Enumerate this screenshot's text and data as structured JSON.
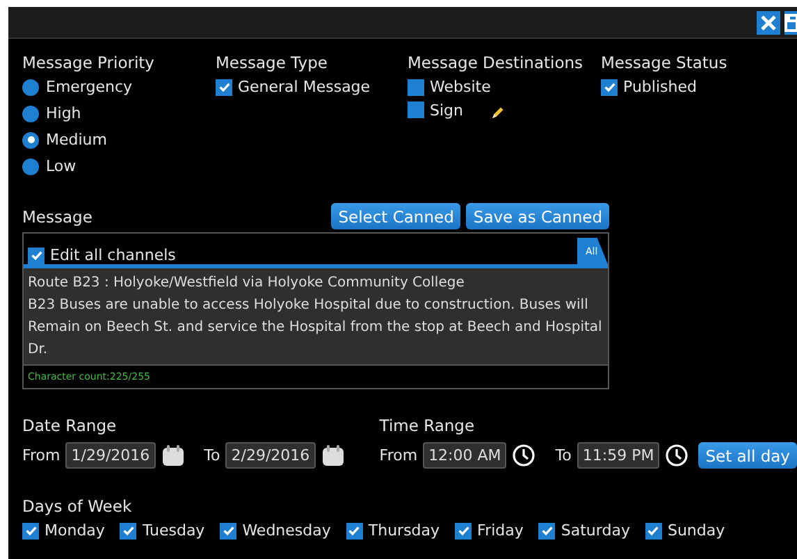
{
  "priority": {
    "label": "Message Priority",
    "options": [
      {
        "label": "Emergency",
        "selected": false
      },
      {
        "label": "High",
        "selected": false
      },
      {
        "label": "Medium",
        "selected": true
      },
      {
        "label": "Low",
        "selected": false
      }
    ]
  },
  "type": {
    "label": "Message Type",
    "options": [
      {
        "label": "General Message",
        "checked": true
      }
    ]
  },
  "destinations": {
    "label": "Message Destinations",
    "options": [
      {
        "label": "Website",
        "checked": false,
        "editable": false
      },
      {
        "label": "Sign",
        "checked": false,
        "editable": true
      }
    ]
  },
  "status": {
    "label": "Message Status",
    "options": [
      {
        "label": "Published",
        "checked": true
      }
    ]
  },
  "message": {
    "label": "Message",
    "buttons": [
      "Select Canned",
      "Save as Canned"
    ],
    "edit_all": {
      "label": "Edit all channels",
      "checked": true
    },
    "tabs": [
      {
        "label": "All",
        "selected": true
      }
    ],
    "value": "Route B23 : Holyoke/Westfield via Holyoke Community College\nB23 Buses are unable to access Holyoke Hospital due to construction. Buses will Remain on Beech St. and service the Hospital from the stop at Beech and Hospital Dr.",
    "char_count": "Character count:225/255"
  },
  "date_range": {
    "label": "Date Range",
    "from_label": "From",
    "from": "1/29/2016",
    "to_label": "To",
    "to": "2/29/2016"
  },
  "time_range": {
    "label": "Time Range",
    "from_label": "From",
    "from": "12:00 AM",
    "to_label": "To",
    "to": "11:59 PM",
    "button": "Set all day"
  },
  "days": {
    "label": "Days of Week",
    "items": [
      {
        "label": "Monday",
        "checked": true
      },
      {
        "label": "Tuesday",
        "checked": true
      },
      {
        "label": "Wednesday",
        "checked": true
      },
      {
        "label": "Thursday",
        "checked": true
      },
      {
        "label": "Friday",
        "checked": true
      },
      {
        "label": "Saturday",
        "checked": true
      },
      {
        "label": "Sunday",
        "checked": true
      }
    ]
  }
}
